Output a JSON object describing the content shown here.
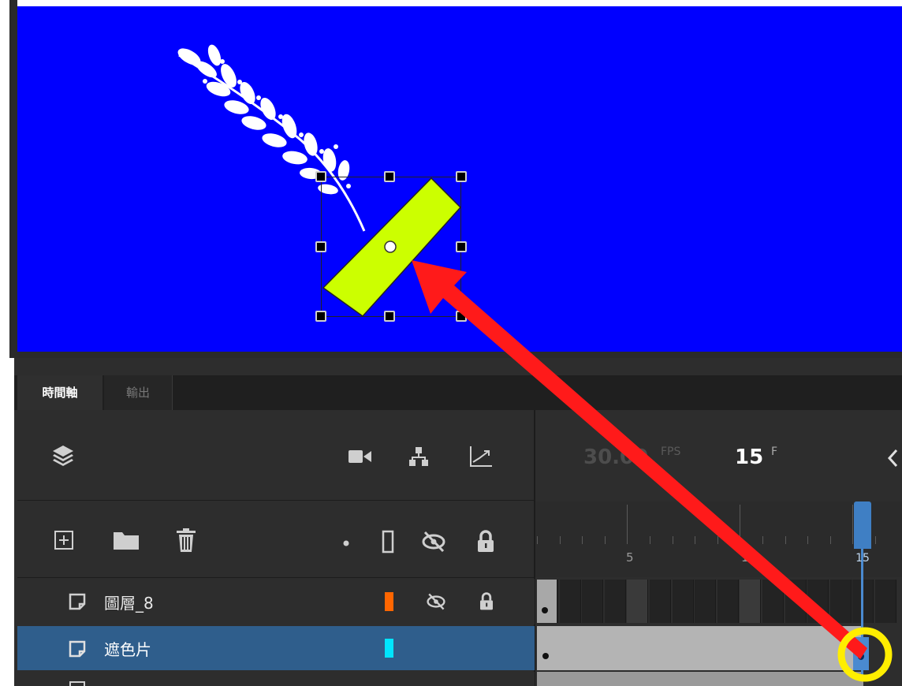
{
  "colors": {
    "stage_background": "#0000ff",
    "mask_bar_fill": "#ccff00",
    "arrow": "#ff1a1a",
    "highlight_ring": "#ffee00",
    "selected_row": "#2f5e8c",
    "playhead": "#3f7fc4"
  },
  "stage": {
    "decoration_icon": "branch-icon",
    "selected_object_icon": "mask-bar-shape"
  },
  "timeline": {
    "tabs": [
      "時間軸",
      "輸出"
    ],
    "fps_value": "30.00",
    "fps_unit": "FPS",
    "current_frame": "15",
    "frame_unit": "F",
    "ruler_labels": [
      "5",
      "10",
      "15"
    ],
    "layers": [
      {
        "name": "圖層_8",
        "color": "#ff6600",
        "hidden": true,
        "locked": true,
        "selected": false
      },
      {
        "name": "遮色片",
        "color": "#00e5ff",
        "hidden": false,
        "locked": false,
        "selected": true
      }
    ]
  }
}
